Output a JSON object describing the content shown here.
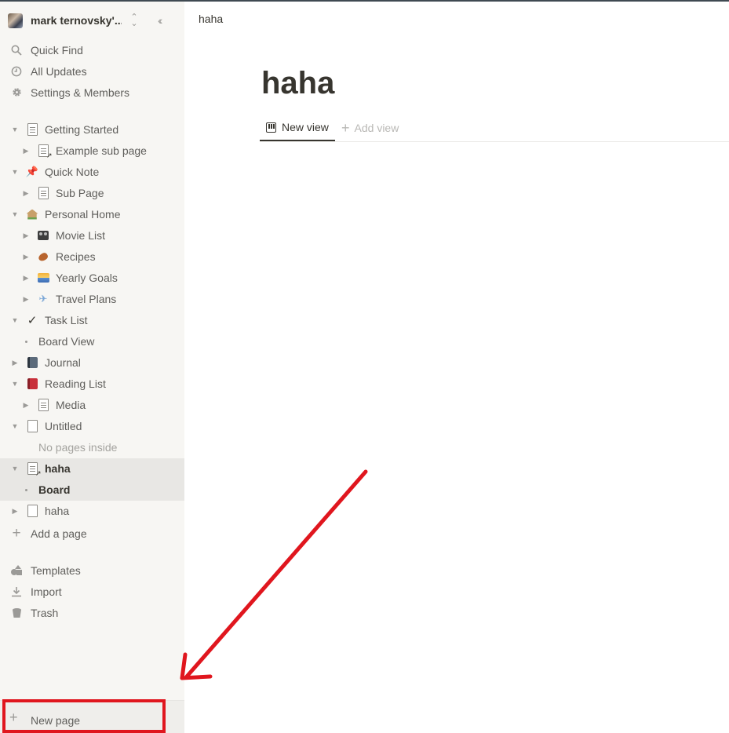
{
  "workspace": {
    "name": "mark ternovsky'...",
    "switch_icon": "chevron-up-down-icon",
    "collapse_icon": "double-chevron-left-icon"
  },
  "nav": [
    {
      "label": "Quick Find",
      "icon": "search-icon"
    },
    {
      "label": "All Updates",
      "icon": "clock-icon"
    },
    {
      "label": "Settings & Members",
      "icon": "gear-icon"
    }
  ],
  "tree": [
    {
      "label": "Getting Started",
      "indent": 0,
      "toggle": "open",
      "icon": "page-lines"
    },
    {
      "label": "Example sub page",
      "indent": 1,
      "toggle": "closed",
      "icon": "page-arrow"
    },
    {
      "label": "Quick Note",
      "indent": 0,
      "toggle": "open",
      "icon": "pin"
    },
    {
      "label": "Sub Page",
      "indent": 1,
      "toggle": "closed",
      "icon": "page-lines"
    },
    {
      "label": "Personal Home",
      "indent": 0,
      "toggle": "open",
      "icon": "house"
    },
    {
      "label": "Movie List",
      "indent": 1,
      "toggle": "closed",
      "icon": "movie"
    },
    {
      "label": "Recipes",
      "indent": 1,
      "toggle": "closed",
      "icon": "leg"
    },
    {
      "label": "Yearly Goals",
      "indent": 1,
      "toggle": "closed",
      "icon": "sunrise"
    },
    {
      "label": "Travel Plans",
      "indent": 1,
      "toggle": "closed",
      "icon": "plane"
    },
    {
      "label": "Task List",
      "indent": 0,
      "toggle": "open",
      "icon": "check"
    },
    {
      "label": "Board View",
      "indent": 1,
      "toggle": "dot",
      "icon": ""
    },
    {
      "label": "Journal",
      "indent": 0,
      "toggle": "closed",
      "icon": "notebook"
    },
    {
      "label": "Reading List",
      "indent": 0,
      "toggle": "open",
      "icon": "book"
    },
    {
      "label": "Media",
      "indent": 1,
      "toggle": "closed",
      "icon": "page-lines"
    },
    {
      "label": "Untitled",
      "indent": 0,
      "toggle": "open",
      "icon": "page-blank"
    },
    {
      "label": "No pages inside",
      "indent": 1,
      "toggle": "none",
      "icon": ""
    },
    {
      "label": "haha",
      "indent": 0,
      "toggle": "open",
      "icon": "page-arrow",
      "selected": true
    },
    {
      "label": "Board",
      "indent": 1,
      "toggle": "dot",
      "icon": "",
      "selected": true
    },
    {
      "label": "haha",
      "indent": 0,
      "toggle": "closed",
      "icon": "page-blank"
    }
  ],
  "add_page": {
    "label": "Add a page",
    "icon": "plus-icon"
  },
  "bottom_nav": [
    {
      "label": "Templates",
      "icon": "shapes-icon"
    },
    {
      "label": "Import",
      "icon": "download-icon"
    },
    {
      "label": "Trash",
      "icon": "trash-icon"
    }
  ],
  "new_page": {
    "label": "New page",
    "icon": "plus-icon"
  },
  "main": {
    "breadcrumb": "haha",
    "title": "haha",
    "tabs": [
      {
        "label": "New view",
        "icon": "board-icon",
        "active": true
      }
    ],
    "add_view": "Add view"
  },
  "annotation": {
    "color": "#e0161e"
  }
}
